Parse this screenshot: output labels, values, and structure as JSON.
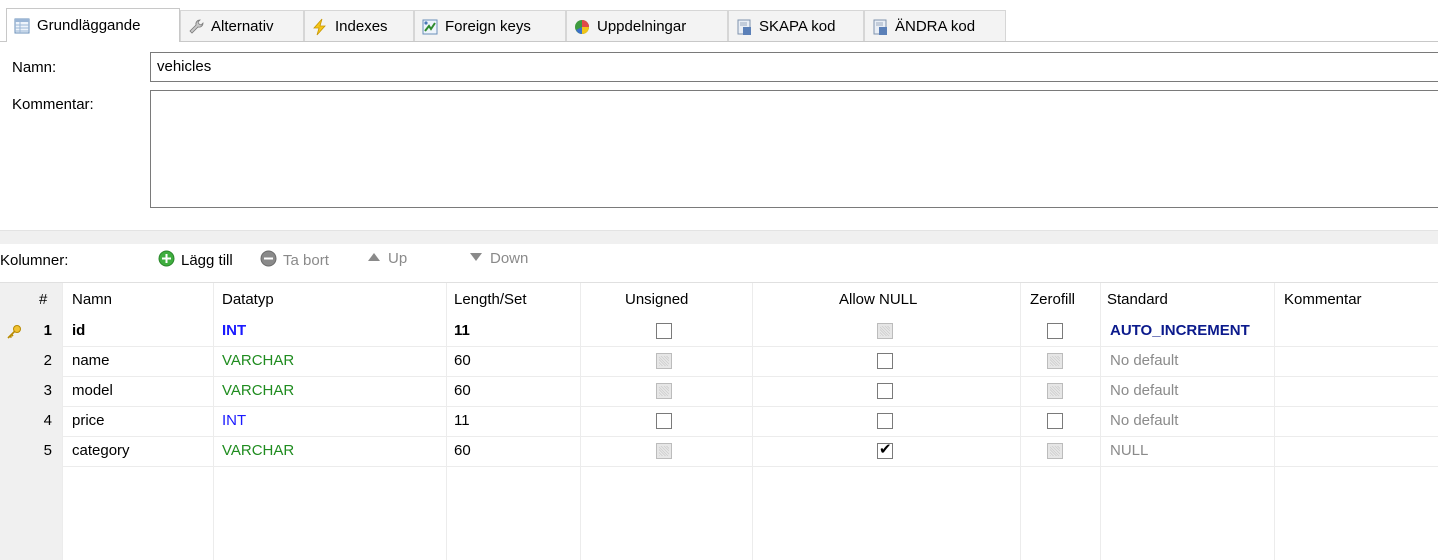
{
  "tabs": [
    {
      "label": "Grundläggande",
      "icon": "table-icon"
    },
    {
      "label": "Alternativ",
      "icon": "wrench-icon"
    },
    {
      "label": "Indexes",
      "icon": "lightning-icon"
    },
    {
      "label": "Foreign keys",
      "icon": "foreign-key-icon"
    },
    {
      "label": "Uppdelningar",
      "icon": "pie-chart-icon"
    },
    {
      "label": "SKAPA kod",
      "icon": "code-icon"
    },
    {
      "label": "ÄNDRA kod",
      "icon": "code-icon"
    }
  ],
  "form": {
    "name_label": "Namn:",
    "name_value": "vehicles",
    "comment_label": "Kommentar:",
    "comment_value": ""
  },
  "toolbar": {
    "columns_label": "Kolumner:",
    "add_label": "Lägg till",
    "remove_label": "Ta bort",
    "up_label": "Up",
    "down_label": "Down"
  },
  "table": {
    "headers": [
      "#",
      "Namn",
      "Datatyp",
      "Length/Set",
      "Unsigned",
      "Allow NULL",
      "Zerofill",
      "Standard",
      "Kommentar"
    ],
    "rows": [
      {
        "num": "1",
        "name": "id",
        "type": "INT",
        "length": "11",
        "unsigned": false,
        "unsigned_enabled": true,
        "allow_null": false,
        "allow_null_enabled": false,
        "zerofill": false,
        "zerofill_enabled": true,
        "default": "AUTO_INCREMENT",
        "comment": "",
        "primary_key": true
      },
      {
        "num": "2",
        "name": "name",
        "type": "VARCHAR",
        "length": "60",
        "unsigned": false,
        "unsigned_enabled": false,
        "allow_null": false,
        "allow_null_enabled": true,
        "zerofill": false,
        "zerofill_enabled": false,
        "default": "No default",
        "comment": ""
      },
      {
        "num": "3",
        "name": "model",
        "type": "VARCHAR",
        "length": "60",
        "unsigned": false,
        "unsigned_enabled": false,
        "allow_null": false,
        "allow_null_enabled": true,
        "zerofill": false,
        "zerofill_enabled": false,
        "default": "No default",
        "comment": ""
      },
      {
        "num": "4",
        "name": "price",
        "type": "INT",
        "length": "11",
        "unsigned": false,
        "unsigned_enabled": true,
        "allow_null": false,
        "allow_null_enabled": true,
        "zerofill": false,
        "zerofill_enabled": true,
        "default": "No default",
        "comment": ""
      },
      {
        "num": "5",
        "name": "category",
        "type": "VARCHAR",
        "length": "60",
        "unsigned": false,
        "unsigned_enabled": false,
        "allow_null": true,
        "allow_null_enabled": true,
        "zerofill": false,
        "zerofill_enabled": false,
        "default": "NULL",
        "comment": ""
      }
    ]
  },
  "colors": {
    "int_type": "#1a1aff",
    "varchar_type": "#1f8c1f",
    "auto_increment": "#0b1a8c",
    "muted": "#8a8a8a",
    "key_icon": "#d9a400"
  }
}
